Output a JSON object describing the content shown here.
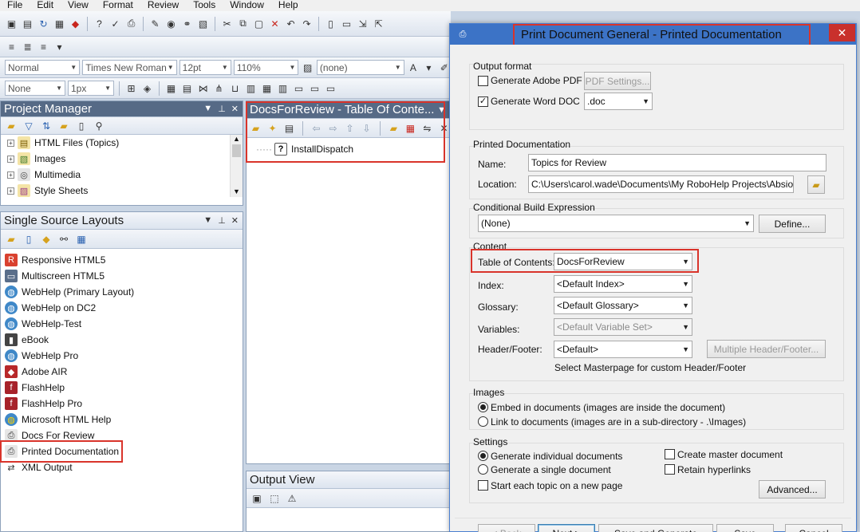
{
  "menu": [
    "File",
    "Edit",
    "View",
    "Format",
    "Review",
    "Tools",
    "Window",
    "Help"
  ],
  "format_bar": {
    "style": "Normal",
    "font": "Times New Roman",
    "size": "12pt",
    "zoom": "110%",
    "none_combo": "(none)"
  },
  "border_bar": {
    "border_style": "None",
    "border_width": "1px"
  },
  "project_manager": {
    "title": "Project Manager",
    "items": [
      "HTML Files (Topics)",
      "Images",
      "Multimedia",
      "Style Sheets"
    ]
  },
  "ssl": {
    "title": "Single Source Layouts",
    "items": [
      "Responsive HTML5",
      "Multiscreen HTML5",
      "WebHelp (Primary Layout)",
      "WebHelp on DC2",
      "WebHelp-Test",
      "eBook",
      "WebHelp Pro",
      "Adobe AIR",
      "FlashHelp",
      "FlashHelp Pro",
      "Microsoft HTML Help",
      "Docs For Review",
      "Printed Documentation",
      "XML Output"
    ]
  },
  "toc_pane": {
    "title": "DocsForReview - Table Of Conte...",
    "item": "InstallDispatch"
  },
  "output_view": {
    "title": "Output View"
  },
  "dialog": {
    "title": "Print Document General - Printed Documentation",
    "output_format": "Output format",
    "gen_pdf": "Generate Adobe PDF",
    "pdf_settings": "PDF Settings...",
    "gen_word": "Generate Word DOC",
    "doc_ext": ".doc",
    "printed_doc": "Printed Documentation",
    "name_label": "Name:",
    "name_value": "Topics for Review",
    "location_label": "Location:",
    "location_value": "C:\\Users\\carol.wade\\Documents\\My RoboHelp Projects\\Absio\\Revi",
    "cbe_label": "Conditional Build Expression",
    "cbe_value": "(None)",
    "define": "Define...",
    "content": "Content",
    "toc_label": "Table of Contents:",
    "toc_value": "DocsForReview",
    "index_label": "Index:",
    "index_value": "<Default Index>",
    "glossary_label": "Glossary:",
    "glossary_value": "<Default Glossary>",
    "variables_label": "Variables:",
    "variables_value": "<Default Variable Set>",
    "hf_label": "Header/Footer:",
    "hf_value": "<Default>",
    "multi_hf": "Multiple Header/Footer...",
    "masterpage_note": "Select Masterpage for custom Header/Footer",
    "images": "Images",
    "embed": "Embed in documents (images are inside the document)",
    "link": "Link to documents (images are in a sub-directory - .\\Images)",
    "settings": "Settings",
    "gen_individual": "Generate individual documents",
    "gen_single": "Generate a single document",
    "new_page": "Start each topic on a new page",
    "master_doc": "Create master document",
    "retain_links": "Retain hyperlinks",
    "advanced": "Advanced...",
    "back": "< Back",
    "next": "Next >",
    "save_generate": "Save and Generate",
    "save": "Save",
    "cancel": "Cancel"
  }
}
